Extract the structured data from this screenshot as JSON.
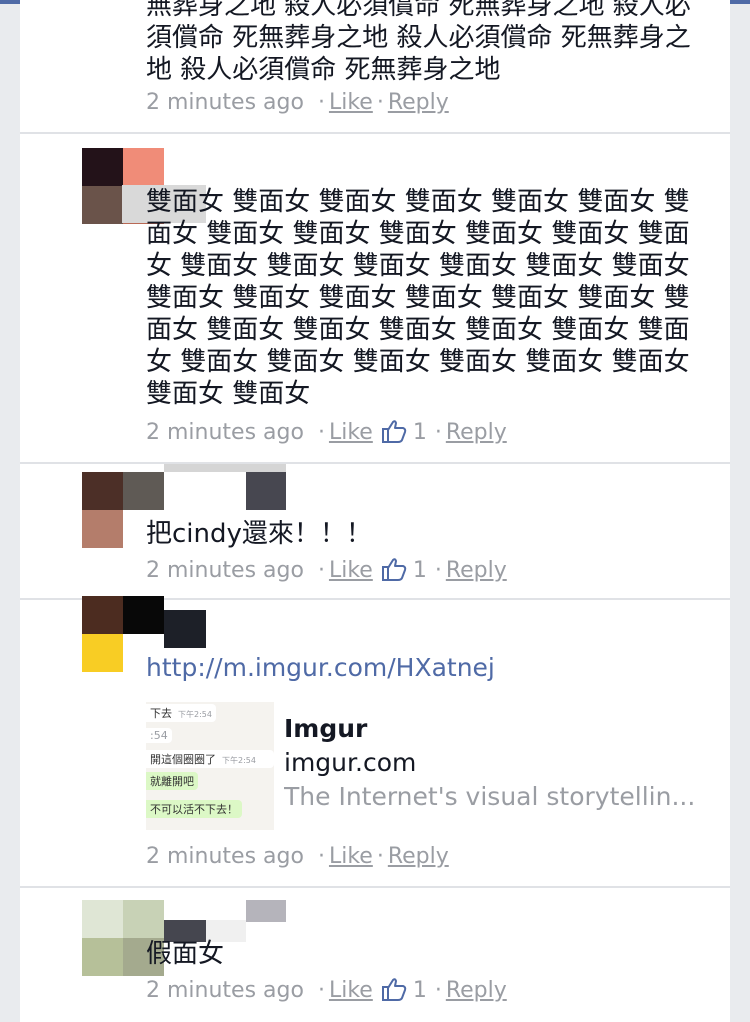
{
  "comments": [
    {
      "text": "無葬身之地 殺人必須償命 死無葬身之地 殺人必須償命 死無葬身之地 殺人必須償命 死無葬身之地 殺人必須償命 死無葬身之地",
      "time": "2 minutes ago",
      "like_label": "Like",
      "reply_label": "Reply"
    },
    {
      "text": "雙面女 雙面女 雙面女 雙面女 雙面女 雙面女 雙面女 雙面女 雙面女 雙面女 雙面女 雙面女 雙面女 雙面女 雙面女 雙面女 雙面女 雙面女 雙面女 雙面女 雙面女 雙面女 雙面女 雙面女 雙面女 雙面女 雙面女 雙面女 雙面女 雙面女 雙面女 雙面女 雙面女 雙面女 雙面女 雙面女 雙面女 雙面女 雙面女 雙面女",
      "time": "2 minutes ago",
      "like_label": "Like",
      "like_count": "1",
      "reply_label": "Reply"
    },
    {
      "text": "把cindy還來！！！",
      "time": "2 minutes ago",
      "like_label": "Like",
      "like_count": "1",
      "reply_label": "Reply"
    },
    {
      "url": "http://m.imgur.com/HXatnej",
      "link_preview": {
        "title": "Imgur",
        "domain": "imgur.com",
        "description": "The Internet's visual storytellin...",
        "thumb_lines": [
          "下去",
          "下午2:54",
          ":54",
          "開這個圈圈了",
          "下午2:54",
          "就離開吧",
          "不可以活不下去！"
        ]
      },
      "time": "2 minutes ago",
      "like_label": "Like",
      "reply_label": "Reply"
    },
    {
      "text": "假面女",
      "time": "2 minutes ago",
      "like_label": "Like",
      "like_count": "1",
      "reply_label": "Reply"
    }
  ],
  "colors": {
    "link_blue": "#4f6aa6",
    "meta_grey": "#9a9da3",
    "text_dark": "#141823",
    "background": "#e9ebee"
  },
  "icons": {
    "like": "thumbs-up-icon"
  }
}
